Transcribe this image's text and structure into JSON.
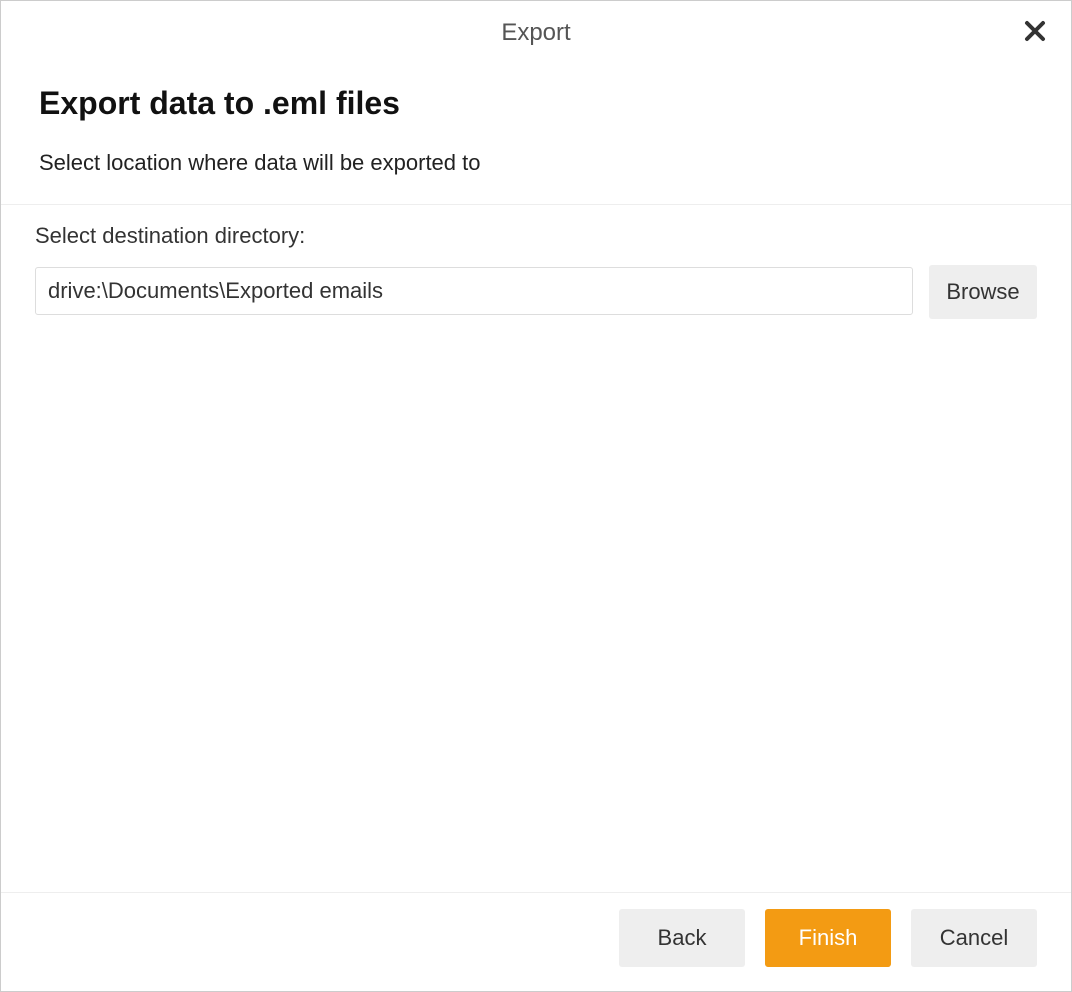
{
  "dialog": {
    "title": "Export",
    "heading": "Export data to .eml files",
    "subheading": "Select location where data will be exported to"
  },
  "form": {
    "destination_label": "Select destination directory:",
    "destination_value": "drive:\\Documents\\Exported emails",
    "browse_label": "Browse"
  },
  "footer": {
    "back_label": "Back",
    "finish_label": "Finish",
    "cancel_label": "Cancel"
  }
}
